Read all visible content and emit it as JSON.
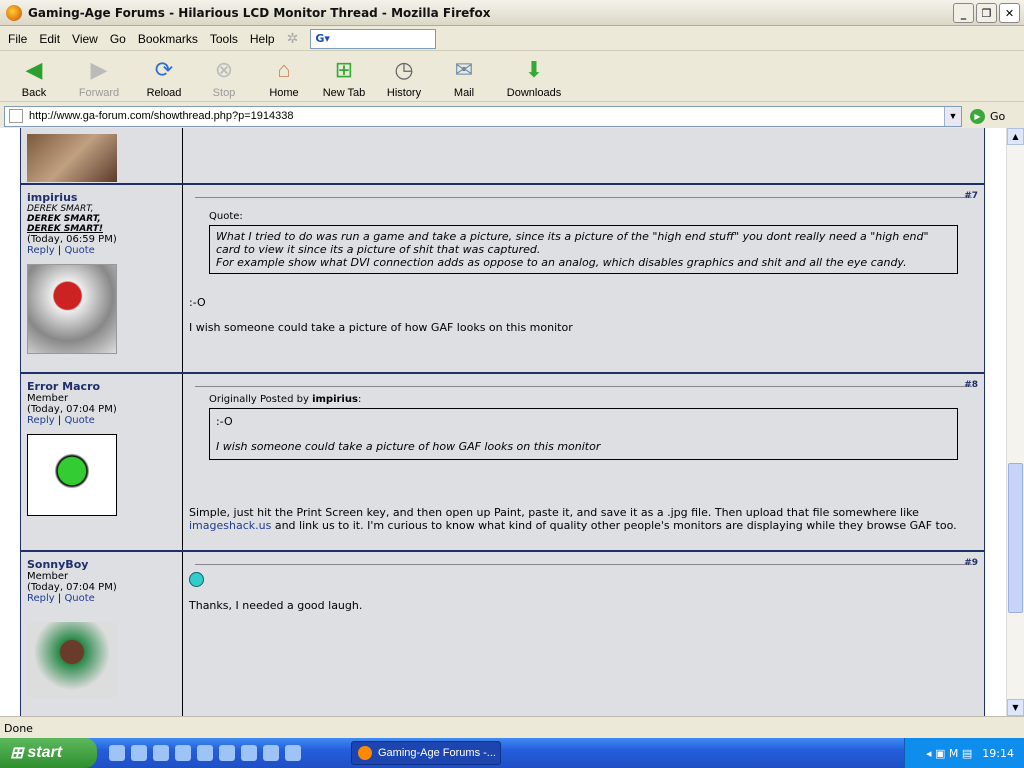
{
  "window": {
    "title": "Gaming-Age Forums - Hilarious LCD Monitor Thread - Mozilla Firefox"
  },
  "menu": [
    "File",
    "Edit",
    "View",
    "Go",
    "Bookmarks",
    "Tools",
    "Help"
  ],
  "search": {
    "engine": "G"
  },
  "toolbar": {
    "back": "Back",
    "forward": "Forward",
    "reload": "Reload",
    "stop": "Stop",
    "home": "Home",
    "newtab": "New Tab",
    "history": "History",
    "mail": "Mail",
    "downloads": "Downloads"
  },
  "address": {
    "url": "http://www.ga-forum.com/showthread.php?p=1914338",
    "go": "Go"
  },
  "posts": [
    {
      "user": "impirius",
      "title1": "DEREK SMART,",
      "title2": "DEREK SMART,",
      "title3a": "DEREK",
      "title3b": "SMART!",
      "time": "(Today, 06:59 PM)",
      "reply": "Reply",
      "quote": "Quote",
      "num": "#7",
      "quote_label": "Quote:",
      "quote_text1": "What I tried to do was run a game and take a picture, since its a picture of the \"high end stuff\" you dont really need a \"high end\" card to view it since its a picture of shit that was captured.",
      "quote_text2": "For example show what DVI connection adds as oppose to an analog, which disables graphics and shit and all the eye candy.",
      "body1": ":-O",
      "body2": "I wish someone could take a picture of how GAF looks on this monitor"
    },
    {
      "user": "Error Macro",
      "title": "Member",
      "time": "(Today, 07:04 PM)",
      "reply": "Reply",
      "quote": "Quote",
      "num": "#8",
      "quote_prefix": "Originally Posted by",
      "quote_author": "impirius",
      "quote_text1": ":-O",
      "quote_text2": "I wish someone could take a picture of how GAF looks on this monitor",
      "body1": "Simple, just hit the Print Screen key, and then open up Paint, paste it, and save it as a .jpg file. Then upload that file somewhere like",
      "link": "imageshack.us",
      "body2": "and link us to it. I'm curious to know what kind of quality other people's monitors are displaying while they browse GAF too."
    },
    {
      "user": "SonnyBoy",
      "title": "Member",
      "time": "(Today, 07:04 PM)",
      "reply": "Reply",
      "quote": "Quote",
      "num": "#9",
      "body": "Thanks, I needed a good laugh."
    }
  ],
  "status": "Done",
  "taskbar": {
    "start": "start",
    "task": "Gaming-Age Forums -...",
    "clock": "19:14"
  }
}
